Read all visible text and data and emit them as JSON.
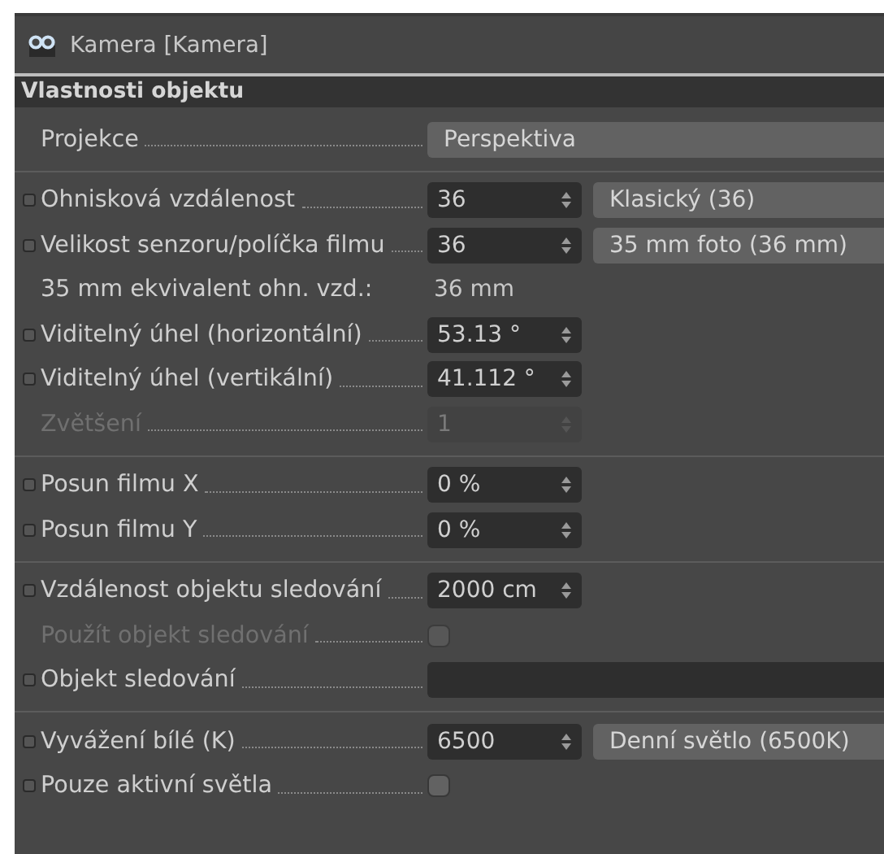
{
  "window": {
    "title": "Kamera [Kamera]"
  },
  "section": {
    "title": "Vlastnosti objektu"
  },
  "groups": [
    {
      "rows": [
        {
          "kind": "dropdown",
          "label": "Projekce",
          "animatable": false,
          "disabled": false,
          "value": "Perspektiva"
        }
      ]
    },
    {
      "rows": [
        {
          "kind": "number",
          "label": "Ohnisková vzdálenost",
          "animatable": true,
          "disabled": false,
          "value": "36",
          "preset": "Klasický (36)"
        },
        {
          "kind": "number",
          "label": "Velikost senzoru/políčka filmu",
          "animatable": true,
          "disabled": false,
          "value": "36",
          "preset": "35 mm foto (36 mm)"
        },
        {
          "kind": "readout",
          "label": "35 mm ekvivalent ohn. vzd.:",
          "animatable": false,
          "disabled": false,
          "value": "36 mm"
        },
        {
          "kind": "number",
          "label": "Viditelný úhel (horizontální)",
          "animatable": true,
          "disabled": false,
          "value": "53.13 °"
        },
        {
          "kind": "number",
          "label": "Viditelný úhel (vertikální)",
          "animatable": true,
          "disabled": false,
          "value": "41.112 °"
        },
        {
          "kind": "number",
          "label": "Zvětšení",
          "animatable": false,
          "disabled": true,
          "value": "1"
        }
      ]
    },
    {
      "rows": [
        {
          "kind": "number",
          "label": "Posun filmu X",
          "animatable": true,
          "disabled": false,
          "value": "0 %"
        },
        {
          "kind": "number",
          "label": "Posun filmu Y",
          "animatable": true,
          "disabled": false,
          "value": "0 %"
        }
      ]
    },
    {
      "rows": [
        {
          "kind": "number",
          "label": "Vzdálenost objektu sledování",
          "animatable": true,
          "disabled": false,
          "value": "2000 cm"
        },
        {
          "kind": "checkbox",
          "label": "Použít objekt sledování",
          "animatable": false,
          "disabled": true,
          "checked": false
        },
        {
          "kind": "link",
          "label": "Objekt sledování",
          "animatable": true,
          "disabled": false
        }
      ]
    },
    {
      "rows": [
        {
          "kind": "number",
          "label": "Vyvážení bílé (K)",
          "animatable": true,
          "disabled": false,
          "value": "6500",
          "preset": "Denní světlo (6500K)"
        },
        {
          "kind": "checkbox",
          "label": "Pouze aktivní světla",
          "animatable": true,
          "disabled": false,
          "checked": false
        }
      ]
    }
  ]
}
